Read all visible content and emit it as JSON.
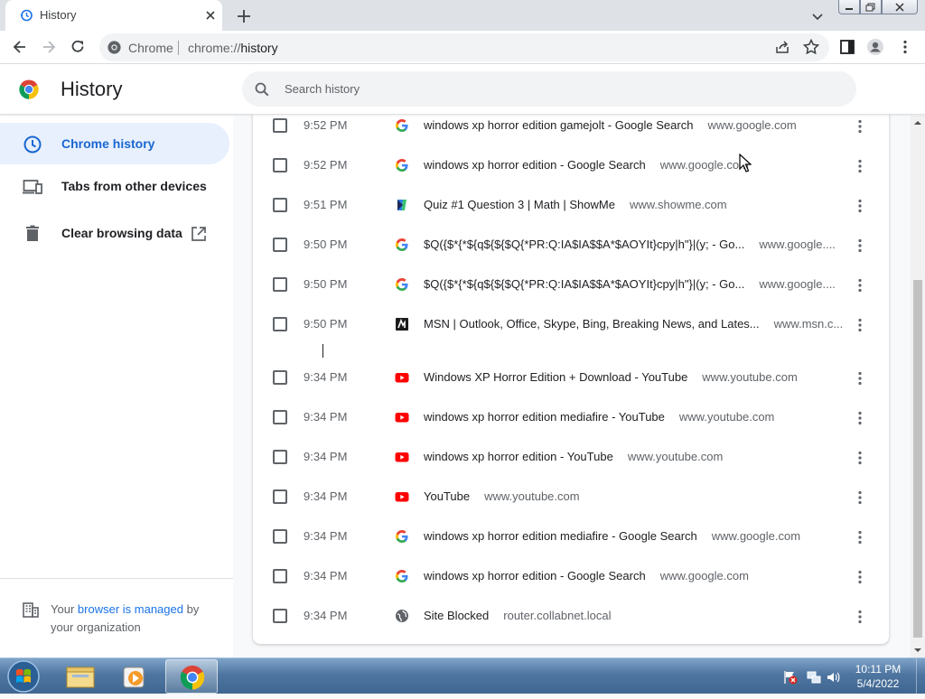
{
  "browser": {
    "tab_title": "History",
    "omnibox_site_label": "Chrome",
    "omnibox_url_prefix": "chrome://",
    "omnibox_url_host": "history"
  },
  "page": {
    "title": "History",
    "search_placeholder": "Search history"
  },
  "sidebar": {
    "items": [
      {
        "label": "Chrome history",
        "icon": "clock-icon",
        "active": true
      },
      {
        "label": "Tabs from other devices",
        "icon": "devices-icon",
        "active": false
      },
      {
        "label": "Clear browsing data",
        "icon": "trash-icon",
        "active": false
      }
    ],
    "managed_prefix": "Your",
    "managed_link": "browser is managed",
    "managed_suffix": "by your organization"
  },
  "history": [
    {
      "time": "9:52 PM",
      "icon": "google",
      "title": "windows xp horror edition gamejolt - Google Search",
      "domain": "www.google.com"
    },
    {
      "time": "9:52 PM",
      "icon": "google",
      "title": "windows xp horror edition - Google Search",
      "domain": "www.google.com"
    },
    {
      "time": "9:51 PM",
      "icon": "showme",
      "title": "Quiz #1 Question 3 | Math | ShowMe",
      "domain": "www.showme.com"
    },
    {
      "time": "9:50 PM",
      "icon": "google",
      "title": "$Q({$*{*${q${${$Q{*PR:Q:IA$IA$$A*$AOYIt}cpy|h\"}|(y; - Go...",
      "domain": "www.google...."
    },
    {
      "time": "9:50 PM",
      "icon": "google",
      "title": "$Q({$*{*${q${${$Q{*PR:Q:IA$IA$$A*$AOYIt}cpy|h\"}|(y; - Go...",
      "domain": "www.google...."
    },
    {
      "time": "9:50 PM",
      "icon": "msn",
      "title": "MSN | Outlook, Office, Skype, Bing, Breaking News, and Lates...",
      "domain": "www.msn.c..."
    },
    {
      "time": "9:34 PM",
      "icon": "youtube",
      "title": "Windows XP Horror Edition + Download - YouTube",
      "domain": "www.youtube.com"
    },
    {
      "time": "9:34 PM",
      "icon": "youtube",
      "title": "windows xp horror edition mediafire - YouTube",
      "domain": "www.youtube.com"
    },
    {
      "time": "9:34 PM",
      "icon": "youtube",
      "title": "windows xp horror edition - YouTube",
      "domain": "www.youtube.com"
    },
    {
      "time": "9:34 PM",
      "icon": "youtube",
      "title": "YouTube",
      "domain": "www.youtube.com"
    },
    {
      "time": "9:34 PM",
      "icon": "google",
      "title": "windows xp horror edition mediafire - Google Search",
      "domain": "www.google.com"
    },
    {
      "time": "9:34 PM",
      "icon": "google",
      "title": "windows xp horror edition - Google Search",
      "domain": "www.google.com"
    },
    {
      "time": "9:34 PM",
      "icon": "globe",
      "title": "Site Blocked",
      "domain": "router.collabnet.local"
    }
  ],
  "taskbar": {
    "time": "10:11 PM",
    "date": "5/4/2022"
  },
  "colors": {
    "accent": "#1a73e8",
    "active_nav_bg": "#e8f0fe",
    "youtube_red": "#ff0000"
  }
}
